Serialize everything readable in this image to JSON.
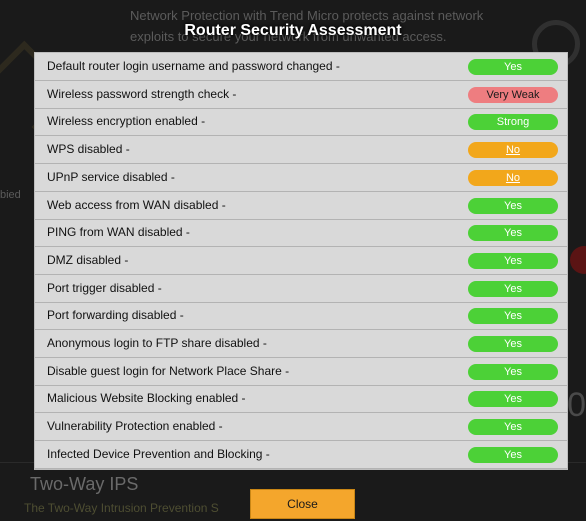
{
  "modal": {
    "title": "Router Security Assessment",
    "close_label": "Close",
    "items": [
      {
        "label": "Default router login username and password changed -",
        "status": "Yes",
        "tone": "green"
      },
      {
        "label": "Wireless password strength check -",
        "status": "Very Weak",
        "tone": "red"
      },
      {
        "label": "Wireless encryption enabled -",
        "status": "Strong",
        "tone": "green"
      },
      {
        "label": "WPS disabled -",
        "status": "No",
        "tone": "orange"
      },
      {
        "label": "UPnP service disabled -",
        "status": "No",
        "tone": "orange"
      },
      {
        "label": "Web access from WAN disabled -",
        "status": "Yes",
        "tone": "green"
      },
      {
        "label": "PING from WAN disabled -",
        "status": "Yes",
        "tone": "green"
      },
      {
        "label": "DMZ disabled -",
        "status": "Yes",
        "tone": "green"
      },
      {
        "label": "Port trigger disabled -",
        "status": "Yes",
        "tone": "green"
      },
      {
        "label": "Port forwarding disabled -",
        "status": "Yes",
        "tone": "green"
      },
      {
        "label": "Anonymous login to FTP share disabled -",
        "status": "Yes",
        "tone": "green"
      },
      {
        "label": "Disable guest login for Network Place Share -",
        "status": "Yes",
        "tone": "green"
      },
      {
        "label": "Malicious Website Blocking enabled -",
        "status": "Yes",
        "tone": "green"
      },
      {
        "label": "Vulnerability Protection enabled -",
        "status": "Yes",
        "tone": "green"
      },
      {
        "label": "Infected Device Prevention and Blocking -",
        "status": "Yes",
        "tone": "green"
      }
    ]
  },
  "background": {
    "line1": "Network Protection with Trend Micro protects against network",
    "line2": "exploits to secure your network from unwanted access.",
    "side_fragment": "bied",
    "two_way_title": "Two-Way IPS",
    "two_way_desc": "The Two-Way Intrusion Prevention S",
    "right_zero": "0"
  },
  "colors": {
    "green": "#4cd137",
    "red": "#ee7d80",
    "orange": "#f2a71b",
    "close_button": "#f4a62c",
    "panel": "#d9d9d9"
  }
}
